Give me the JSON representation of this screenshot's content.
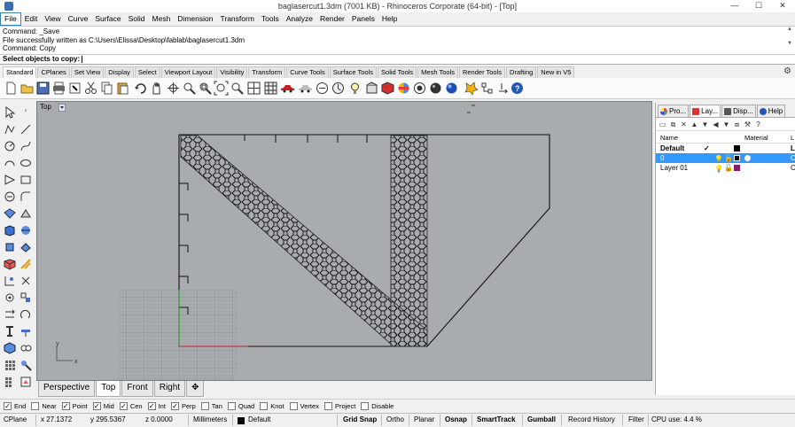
{
  "window": {
    "title": "baglasercut1.3dm (7001 KB) - Rhinoceros Corporate (64-bit) - [Top]",
    "min": "—",
    "max": "☐",
    "close": "✕"
  },
  "menu": [
    "File",
    "Edit",
    "View",
    "Curve",
    "Surface",
    "Solid",
    "Mesh",
    "Dimension",
    "Transform",
    "Tools",
    "Analyze",
    "Render",
    "Panels",
    "Help"
  ],
  "command_history": [
    "Command: _Save",
    "File successfully written as C:\\Users\\Elissa\\Desktop\\fablab\\baglasercut1.3dm",
    "Command: Copy"
  ],
  "command_prompt": "Select objects to copy:",
  "toolbar_tabs": [
    "Standard",
    "CPlanes",
    "Set View",
    "Display",
    "Select",
    "Viewport Layout",
    "Visibility",
    "Transform",
    "Curve Tools",
    "Surface Tools",
    "Solid Tools",
    "Mesh Tools",
    "Render Tools",
    "Drafting",
    "New in V5"
  ],
  "viewport": {
    "name": "Top",
    "axis_x": "x",
    "axis_y": "y"
  },
  "viewport_tabs": [
    "Perspective",
    "Top",
    "Front",
    "Right",
    "✥"
  ],
  "panel": {
    "tabs": [
      "Pro...",
      "Lay...",
      "Disp...",
      "Help"
    ],
    "headers": {
      "name": "Name",
      "material": "Material",
      "extra": "L"
    },
    "layers": [
      {
        "name": "Default",
        "check": "✓",
        "color": "#000000",
        "bold": true,
        "selected": false,
        "edge": "L"
      },
      {
        "name": "0",
        "check": "",
        "color": "#000000",
        "bold": false,
        "selected": true,
        "edge": "C"
      },
      {
        "name": "Layer 01",
        "check": "",
        "color": "#8b1a6b",
        "bold": false,
        "selected": false,
        "edge": "C"
      }
    ]
  },
  "osnaps": [
    {
      "label": "End",
      "checked": true
    },
    {
      "label": "Near",
      "checked": false
    },
    {
      "label": "Point",
      "checked": true
    },
    {
      "label": "Mid",
      "checked": true
    },
    {
      "label": "Cen",
      "checked": true
    },
    {
      "label": "Int",
      "checked": true
    },
    {
      "label": "Perp",
      "checked": true
    },
    {
      "label": "Tan",
      "checked": false
    },
    {
      "label": "Quad",
      "checked": false
    },
    {
      "label": "Knot",
      "checked": false
    },
    {
      "label": "Vertex",
      "checked": false
    },
    {
      "label": "Project",
      "checked": false
    },
    {
      "label": "Disable",
      "checked": false
    }
  ],
  "status": {
    "cplane": "CPlane",
    "x": "x 27.1372",
    "y": "y 295.5367",
    "z": "z 0.0000",
    "units": "Millimeters",
    "layer": "Default",
    "grid_snap": "Grid Snap",
    "ortho": "Ortho",
    "planar": "Planar",
    "osnap": "Osnap",
    "smarttrack": "SmartTrack",
    "gumball": "Gumball",
    "history": "Record History",
    "filter": "Filter",
    "cpu": "CPU use: 4.4 %"
  },
  "icons": {
    "toolbar": [
      "new-icon",
      "open-icon",
      "save-icon",
      "print-icon",
      "import-icon",
      "cut-icon",
      "copy-icon",
      "paste-icon",
      "undo-icon",
      "pan-icon",
      "rotate-view-icon",
      "zoom-icon",
      "zoom-window-icon",
      "zoom-extents-icon",
      "zoom-selected-icon",
      "four-views-icon",
      "grid-icon",
      "car-icon",
      "cplane-icon",
      "lock-icon",
      "light-icon",
      "shade-icon",
      "material-icon",
      "render-icon",
      "sphere-icon",
      "globe-icon",
      "options-icon",
      "named-view-icon",
      "help-icon"
    ]
  }
}
